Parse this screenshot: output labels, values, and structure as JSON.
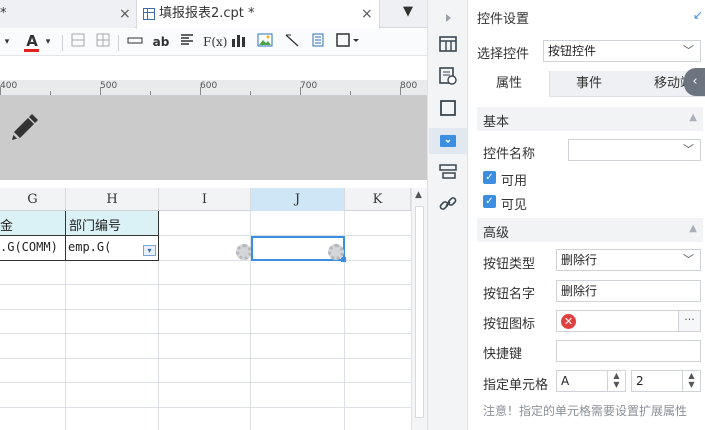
{
  "editor": {
    "tabs": [
      {
        "label": "*"
      },
      {
        "label": "填报报表2.cpt *"
      }
    ],
    "tab_close": "×",
    "tab_menu": "▼",
    "toolbar": {
      "font_color_label": "A",
      "text_ab": "ab",
      "formula_label": "F(x)"
    },
    "ruler": {
      "marks": [
        "400",
        "500",
        "600",
        "700",
        "800"
      ]
    },
    "grid": {
      "columns": [
        "G",
        "H",
        "I",
        "J",
        "K"
      ],
      "selected_column": "J",
      "header_cells": [
        "金",
        "部门编号"
      ],
      "data_cells": [
        ".G(COMM)",
        "emp.G("
      ]
    }
  },
  "icons": {
    "strip": [
      "play-icon",
      "layout-icon",
      "dataset-icon",
      "frame-icon",
      "widget-icon",
      "condition-icon",
      "link-icon"
    ],
    "pencil": "pencil-icon",
    "gear": "gear-icon"
  },
  "colors": {
    "accent": "#3c8ee0",
    "header_fill": "#daf2f5",
    "selected_col": "#cfe6f6",
    "error": "#e0413e"
  },
  "panel": {
    "title": "控件设置",
    "select_widget_label": "选择控件",
    "select_widget_value": "按钮控件",
    "tabs": [
      "属性",
      "事件",
      "移动端"
    ],
    "active_tab": "属性",
    "basic_section": "基本",
    "widget_name_label": "控件名称",
    "widget_name_value": "",
    "enabled_label": "可用",
    "visible_label": "可见",
    "advanced_section": "高级",
    "button_type_label": "按钮类型",
    "button_type_value": "删除行",
    "button_name_label": "按钮名字",
    "button_name_value": "删除行",
    "button_icon_label": "按钮图标",
    "shortcut_label": "快捷键",
    "shortcut_value": "",
    "target_cell_label": "指定单元格",
    "target_col_value": "A",
    "target_row_value": "2",
    "note": "注意！指定的单元格需要设置扩展属性"
  }
}
